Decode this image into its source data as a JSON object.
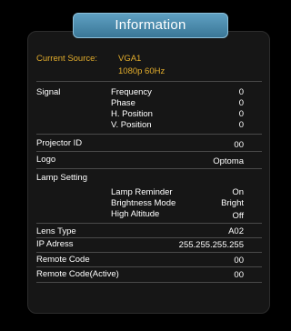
{
  "title": "Information",
  "source": {
    "label": "Current Source:",
    "value": "VGA1",
    "detail": "1080p 60Hz"
  },
  "signal": {
    "label": "Signal",
    "items": [
      {
        "label": "Frequency",
        "value": "0"
      },
      {
        "label": "Phase",
        "value": "0"
      },
      {
        "label": "H. Position",
        "value": "0"
      },
      {
        "label": "V. Position",
        "value": "0"
      }
    ]
  },
  "projector_id": {
    "label": "Projector ID",
    "value": "00"
  },
  "logo": {
    "label": "Logo",
    "value": "Optoma"
  },
  "lamp": {
    "label": "Lamp Setting",
    "items": [
      {
        "label": "Lamp Reminder",
        "value": "On"
      },
      {
        "label": "Brightness Mode",
        "value": "Bright"
      },
      {
        "label": "High Altitude",
        "value": "Off"
      }
    ]
  },
  "lens_type": {
    "label": "Lens Type",
    "value": "A02"
  },
  "ip_address": {
    "label": "IP Adress",
    "value": "255.255.255.255"
  },
  "remote_code": {
    "label": "Remote Code",
    "value": "00"
  },
  "remote_code_active": {
    "label": "Remote Code(Active)",
    "value": "00"
  },
  "colors": {
    "accent_tab": "#4a8bae",
    "source_text": "#e3ad2c",
    "panel_bg": "#161616"
  }
}
